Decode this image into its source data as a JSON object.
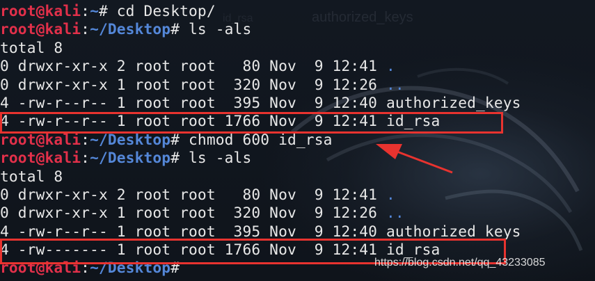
{
  "terminal": {
    "background_text": [
      "authorized_keys",
      "id_rsa"
    ],
    "lines": [
      {
        "kind": "prompt",
        "user_host": "root@kali",
        "sep": ":",
        "path": "~",
        "hash": "# ",
        "command": "cd Desktop/"
      },
      {
        "kind": "prompt",
        "user_host": "root@kali",
        "sep": ":",
        "path": "~/Desktop",
        "hash": "# ",
        "command": "ls -als"
      },
      {
        "kind": "text",
        "text": "total 8"
      },
      {
        "kind": "entry",
        "prefix": "0 drwxr-xr-x 2 root root   80 Nov  9 12:41 ",
        "name": ".",
        "name_is_dir": true
      },
      {
        "kind": "entry",
        "prefix": "0 drwxr-xr-x 1 root root  320 Nov  9 12:26 ",
        "name": "..",
        "name_is_dir": true
      },
      {
        "kind": "entry",
        "prefix": "4 -rw-r--r-- 1 root root  395 Nov  9 12:40 ",
        "name": "authorized_keys",
        "name_is_dir": false
      },
      {
        "kind": "entry",
        "prefix": "4 -rw-r--r-- 1 root root 1766 Nov  9 12:41 ",
        "name": "id_rsa",
        "name_is_dir": false
      },
      {
        "kind": "prompt",
        "user_host": "root@kali",
        "sep": ":",
        "path": "~/Desktop",
        "hash": "# ",
        "command": "chmod 600 id_rsa"
      },
      {
        "kind": "prompt",
        "user_host": "root@kali",
        "sep": ":",
        "path": "~/Desktop",
        "hash": "# ",
        "command": "ls -als"
      },
      {
        "kind": "text",
        "text": "total 8"
      },
      {
        "kind": "entry",
        "prefix": "0 drwxr-xr-x 2 root root   80 Nov  9 12:41 ",
        "name": ".",
        "name_is_dir": true
      },
      {
        "kind": "entry",
        "prefix": "0 drwxr-xr-x 1 root root  320 Nov  9 12:26 ",
        "name": "..",
        "name_is_dir": true
      },
      {
        "kind": "entry",
        "prefix": "4 -rw-r--r-- 1 root root  395 Nov  9 12:40 ",
        "name": "authorized_keys",
        "name_is_dir": false
      },
      {
        "kind": "entry",
        "prefix": "4 -rw------- 1 root root 1766 Nov  9 12:41 ",
        "name": "id_rsa",
        "name_is_dir": false
      },
      {
        "kind": "prompt",
        "user_host": "root@kali",
        "sep": ":",
        "path": "~/Desktop",
        "hash": "#",
        "command": ""
      }
    ]
  },
  "annotations": {
    "highlight_color": "#e8332f",
    "watermark": "https://blog.csdn.net/qq_43233085"
  },
  "colors": {
    "prompt_user": "#e2304a",
    "prompt_path": "#5487d8",
    "text": "#e8e8e8",
    "background": "#10151d"
  }
}
